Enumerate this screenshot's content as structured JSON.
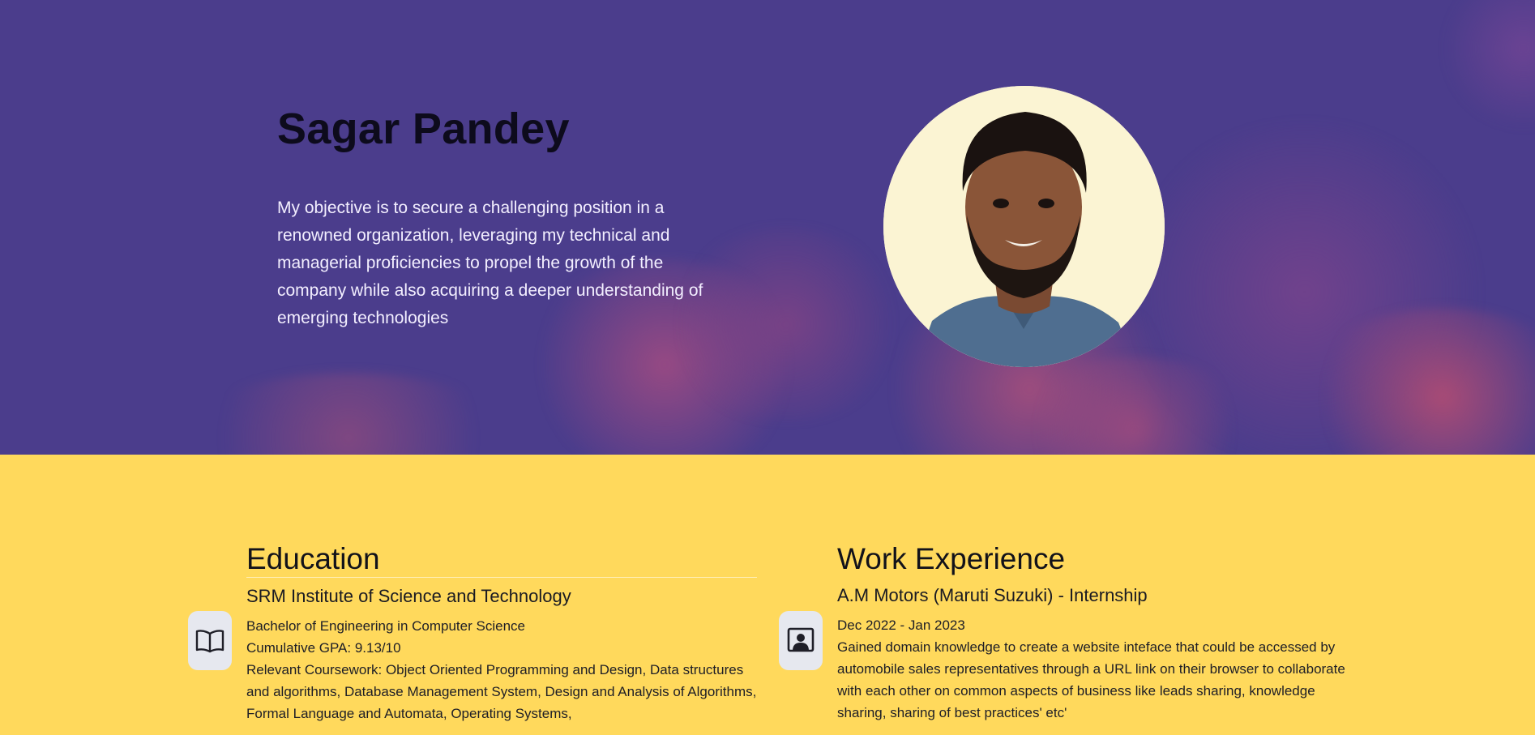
{
  "hero": {
    "name": "Sagar Pandey",
    "objective": "My objective is to secure a challenging position in a renowned organization, leveraging my technical and managerial proficiencies to propel the growth of the company while also acquiring a deeper understanding of emerging technologies",
    "background_color": "#4b3d8c"
  },
  "education": {
    "title": "Education",
    "icon": "book-icon",
    "institution": "SRM Institute of Science and Technology",
    "degree": "Bachelor of Engineering in Computer Science",
    "gpa": "Cumulative GPA: 9.13/10",
    "coursework": "Relevant Coursework: Object Oriented Programming and Design, Data structures and algorithms, Database Management System, Design and Analysis of Algorithms, Formal Language and Automata, Operating Systems,"
  },
  "work": {
    "title": "Work Experience",
    "icon": "presenter-icon",
    "company": "A.M Motors (Maruti Suzuki) - Internship",
    "dates": "Dec 2022 - Jan 2023",
    "description": "Gained domain knowledge to create a website inteface that could be accessed by automobile sales representatives through a URL link on their browser to collaborate with each other on common aspects of business like leads sharing, knowledge sharing, sharing of best practices' etc'"
  },
  "colors": {
    "section_background": "#ffd95c",
    "icon_box": "#e6e8ef"
  }
}
